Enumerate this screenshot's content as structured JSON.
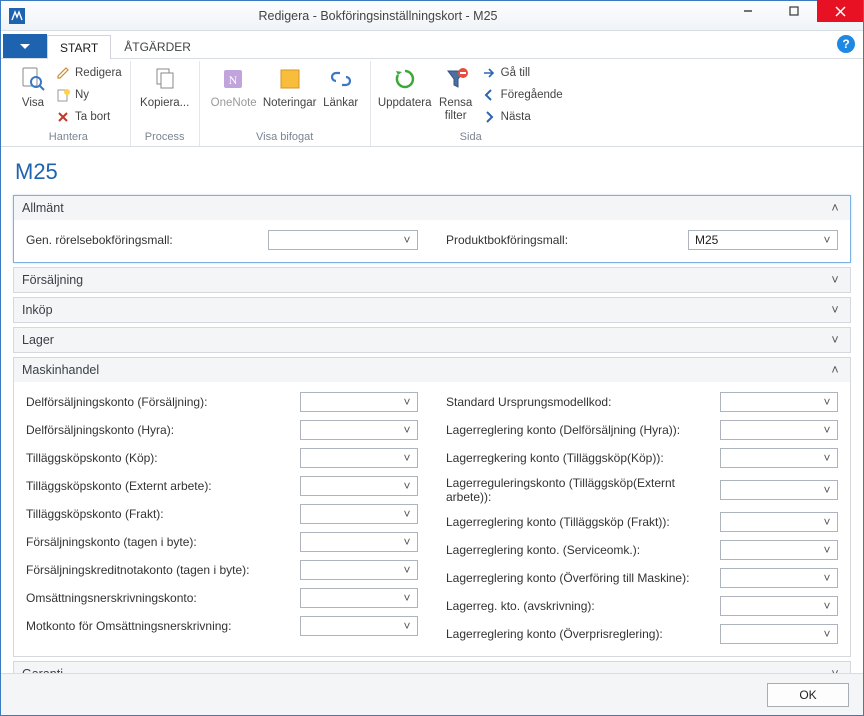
{
  "window": {
    "title": "Redigera - Bokföringsinställningskort - M25"
  },
  "tabs": {
    "start": "START",
    "actions": "ÅTGÄRDER"
  },
  "ribbon": {
    "hantera": {
      "label": "Hantera",
      "visa": "Visa",
      "redigera": "Redigera",
      "ny": "Ny",
      "ta_bort": "Ta bort"
    },
    "process": {
      "label": "Process",
      "kopiera": "Kopiera..."
    },
    "visa_bifogat": {
      "label": "Visa bifogat",
      "onenote": "OneNote",
      "noteringar": "Noteringar",
      "lankar": "Länkar"
    },
    "sida": {
      "label": "Sida",
      "uppdatera": "Uppdatera",
      "rensa_filter": "Rensa\nfilter",
      "ga_till": "Gå till",
      "foregaende": "Föregående",
      "nasta": "Nästa"
    }
  },
  "page": {
    "title": "M25"
  },
  "sections": {
    "allmant": {
      "title": "Allmänt",
      "expanded": true,
      "fields": {
        "gen_rorelse": {
          "label": "Gen. rörelsebokföringsmall:",
          "value": ""
        },
        "produkt": {
          "label": "Produktbokföringsmall:",
          "value": "M25"
        }
      }
    },
    "forsaljning": {
      "title": "Försäljning",
      "expanded": false
    },
    "inkop": {
      "title": "Inköp",
      "expanded": false
    },
    "lager": {
      "title": "Lager",
      "expanded": false
    },
    "maskinhandel": {
      "title": "Maskinhandel",
      "expanded": true,
      "left": {
        "delforsaljning_forsaljning": {
          "label": "Delförsäljningskonto (Försäljning):",
          "value": ""
        },
        "delforsaljning_hyra": {
          "label": "Delförsäljningskonto (Hyra):",
          "value": ""
        },
        "tillaggskop_kop": {
          "label": "Tilläggsköpskonto (Köp):",
          "value": ""
        },
        "tillaggskop_externt": {
          "label": "Tilläggsköpskonto (Externt arbete):",
          "value": ""
        },
        "tillaggskop_frakt": {
          "label": "Tilläggsköpskonto (Frakt):",
          "value": ""
        },
        "forsaljning_byte": {
          "label": "Försäljningskonto (tagen i byte):",
          "value": ""
        },
        "forsaljningskredit_byte": {
          "label": "Försäljningskreditnotakonto (tagen i byte):",
          "value": ""
        },
        "omsattningsnerskrivning": {
          "label": "Omsättningsnerskrivningskonto:",
          "value": ""
        },
        "motkonto_omsattning": {
          "label": "Motkonto för Omsättningsnerskrivning:",
          "value": ""
        }
      },
      "right": {
        "standard_ursprung": {
          "label": "Standard Ursprungsmodellkod:",
          "value": ""
        },
        "lagerreg_delf_hyra": {
          "label": "Lagerreglering konto  (Delförsäljning (Hyra)):",
          "value": ""
        },
        "lagerreg_tillagg_kop": {
          "label": "Lagerregkering konto (Tilläggsköp(Köp)):",
          "value": ""
        },
        "lagerreg_tillagg_externt": {
          "label": "Lagerreguleringskonto (Tilläggsköp(Externt arbete)):",
          "value": ""
        },
        "lagerreg_tillagg_frakt": {
          "label": "Lagerreglering konto (Tilläggsköp (Frakt)):",
          "value": ""
        },
        "lagerreg_serviceomk": {
          "label": "Lagerreglering konto. (Serviceomk.):",
          "value": ""
        },
        "lagerreg_overforing": {
          "label": "Lagerreglering konto  (Överföring till Maskine):",
          "value": ""
        },
        "lagerreg_avskrivning": {
          "label": "Lagerreg. kto. (avskrivning):",
          "value": ""
        },
        "lagerreg_overpris": {
          "label": "Lagerreglering konto (Överprisreglering):",
          "value": ""
        }
      }
    },
    "garanti": {
      "title": "Garanti",
      "expanded": false
    }
  },
  "footer": {
    "ok": "OK"
  }
}
